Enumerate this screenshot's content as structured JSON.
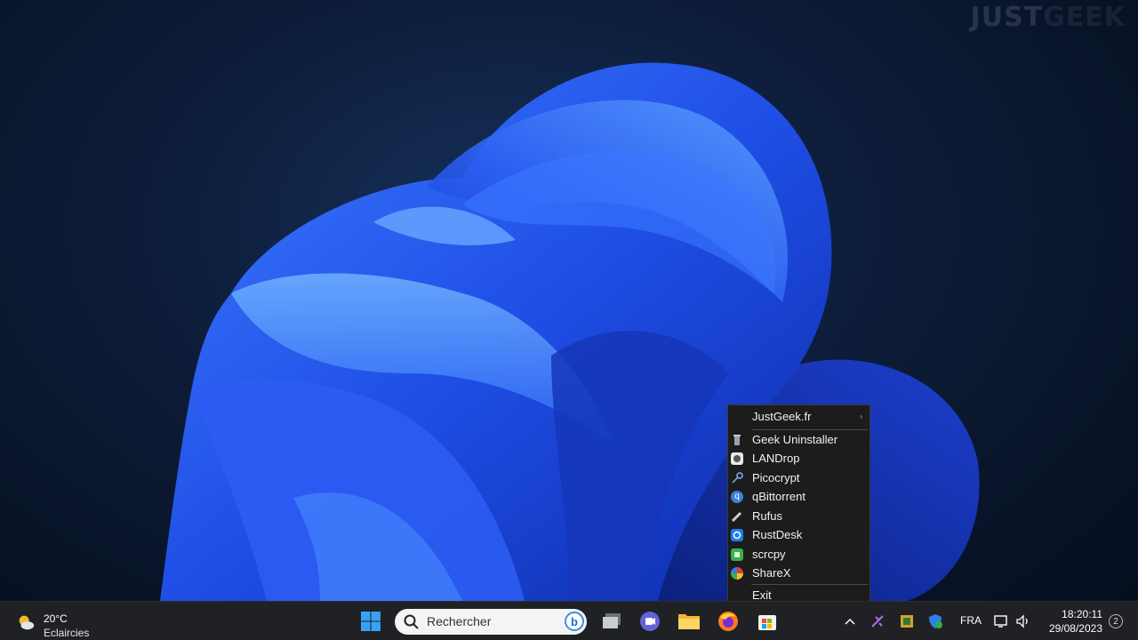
{
  "watermark": {
    "part1": "JUST",
    "part2": "GEEK"
  },
  "context_menu": {
    "header": {
      "label": "JustGeek.fr",
      "submenu_arrow": "›"
    },
    "items": [
      {
        "label": "Geek Uninstaller",
        "icon": "geek-uninstaller-icon"
      },
      {
        "label": "LANDrop",
        "icon": "landrop-icon"
      },
      {
        "label": "Picocrypt",
        "icon": "picocrypt-icon"
      },
      {
        "label": "qBittorrent",
        "icon": "qbittorrent-icon"
      },
      {
        "label": "Rufus",
        "icon": "rufus-icon"
      },
      {
        "label": "RustDesk",
        "icon": "rustdesk-icon"
      },
      {
        "label": "scrcpy",
        "icon": "scrcpy-icon"
      },
      {
        "label": "ShareX",
        "icon": "sharex-icon"
      }
    ],
    "exit_label": "Exit"
  },
  "taskbar": {
    "weather": {
      "temperature": "20°C",
      "condition": "Eclaircies",
      "icon": "partly-sunny-icon"
    },
    "search": {
      "placeholder": "Rechercher"
    },
    "pinned": [
      "start-icon",
      "task-view-icon",
      "teams-icon",
      "file-explorer-icon",
      "firefox-icon",
      "microsoft-store-icon"
    ],
    "tray": {
      "language": "FRA",
      "time": "18:20:11",
      "date": "29/08/2023",
      "notification_count": "2"
    }
  },
  "colors": {
    "menu_bg": "#1c1c1c",
    "taskbar_bg": "#1f2124",
    "accent": "#1d6ed6"
  }
}
